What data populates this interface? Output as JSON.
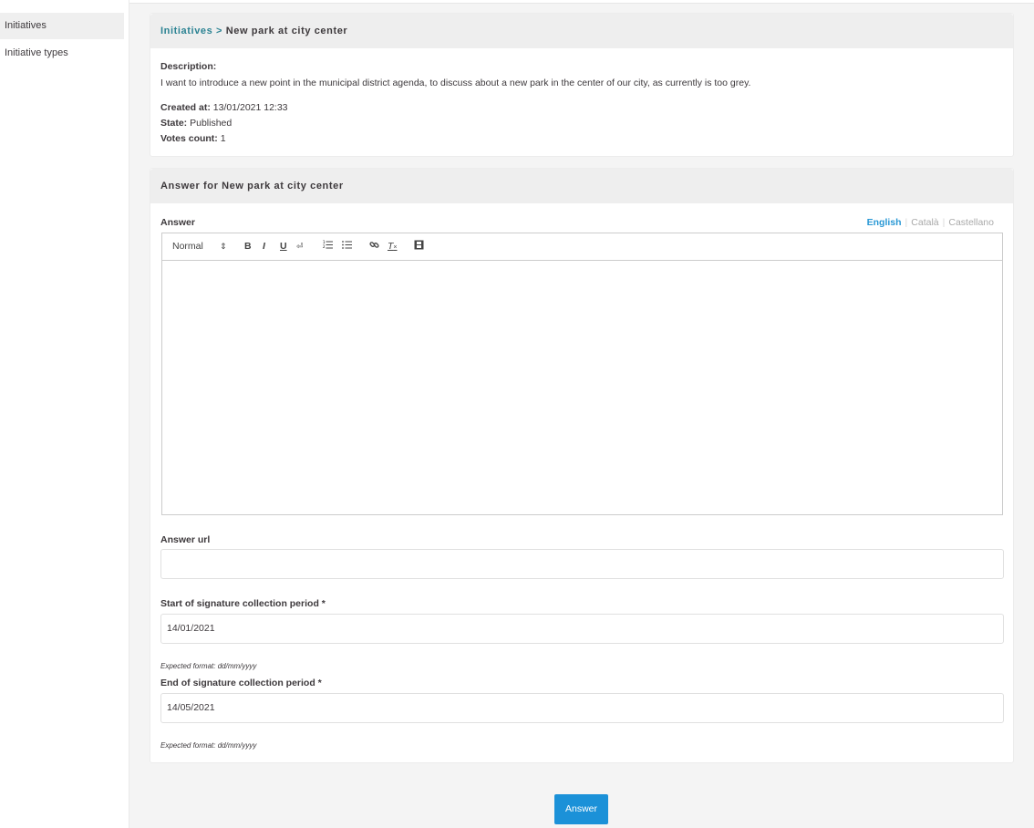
{
  "sidebar": {
    "items": [
      {
        "label": "Initiatives"
      },
      {
        "label": "Initiative types"
      }
    ]
  },
  "initiative": {
    "breadcrumb_root": "Initiatives",
    "breadcrumb_separator": ">",
    "title": "New park at city center",
    "description_label": "Description:",
    "description": "I want to introduce a new point in the municipal district agenda, to discuss about a new park in the center of our city, as currently is too grey.",
    "created_label": "Created at:",
    "created_value": "13/01/2021 12:33",
    "state_label": "State:",
    "state_value": "Published",
    "votes_label": "Votes count:",
    "votes_value": "1"
  },
  "answer_form": {
    "header": "Answer for New park at city center",
    "answer_label": "Answer",
    "languages": [
      {
        "label": "English",
        "active": true
      },
      {
        "label": "Català",
        "active": false
      },
      {
        "label": "Castellano",
        "active": false
      }
    ],
    "toolbar": {
      "format_select": "Normal",
      "format_arrow": "⇕",
      "bold": "B",
      "italic": "I",
      "underline": "U",
      "linebreak": "⏎",
      "clean": "T"
    },
    "answer_url_label": "Answer url",
    "answer_url_value": "",
    "start_label": "Start of signature collection period *",
    "start_value": "14/01/2021",
    "start_help": "Expected format: dd/mm/yyyy",
    "end_label": "End of signature collection period *",
    "end_value": "14/05/2021",
    "end_help": "Expected format: dd/mm/yyyy",
    "submit_label": "Answer"
  },
  "colors": {
    "accent": "#1b91d8",
    "link": "#2c8393",
    "active_language": "#2998d5"
  }
}
